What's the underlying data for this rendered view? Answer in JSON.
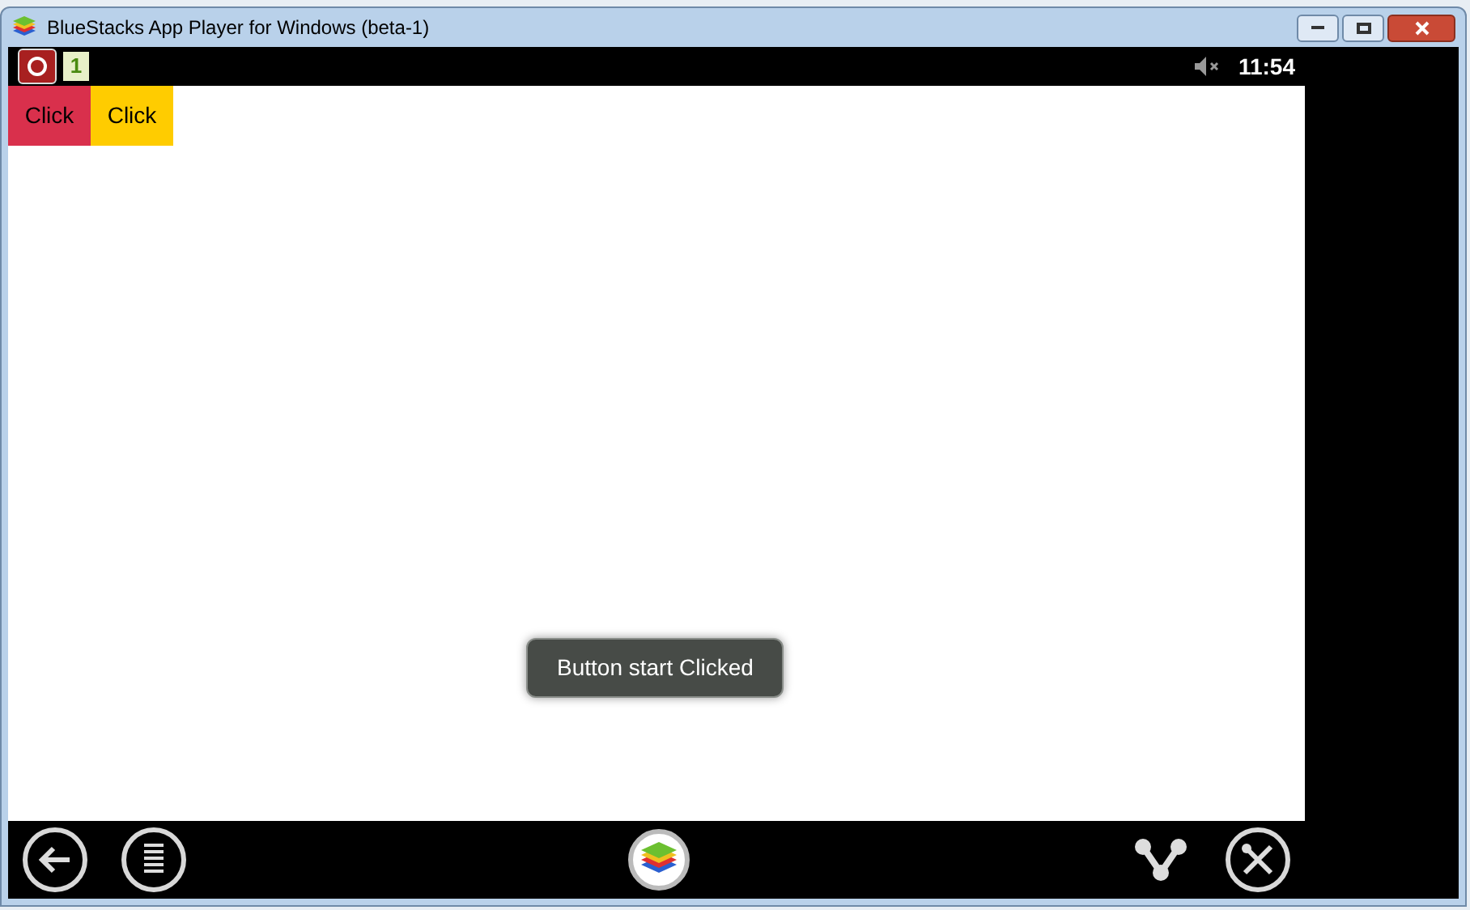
{
  "window": {
    "title": "BlueStacks App Player for Windows (beta-1)"
  },
  "status_bar": {
    "notification": "1",
    "muted": true,
    "time": "11:54"
  },
  "buttons": [
    {
      "label": "Click",
      "color": "#d9304c"
    },
    {
      "label": "Click",
      "color": "#ffcc00"
    }
  ],
  "toast": {
    "text": "Button start Clicked"
  }
}
